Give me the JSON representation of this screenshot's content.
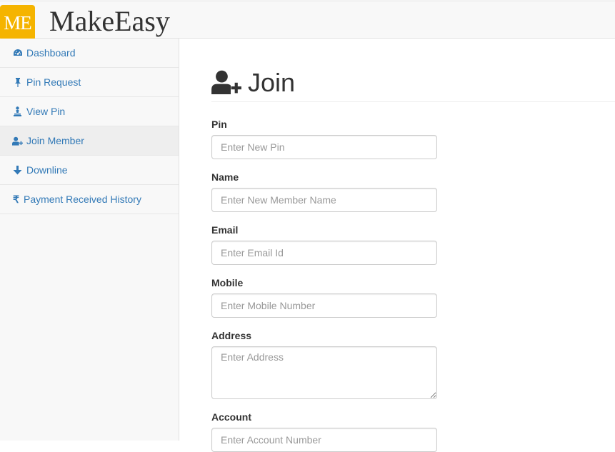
{
  "brand": {
    "logo_text": "ME",
    "name": "MakeEasy",
    "logo_color": "#f5b400"
  },
  "sidebar": {
    "items": [
      {
        "label": "Dashboard",
        "icon": "dashboard-icon",
        "active": false
      },
      {
        "label": "Pin Request",
        "icon": "pushpin-icon",
        "active": false
      },
      {
        "label": "View Pin",
        "icon": "pawn-icon",
        "active": false
      },
      {
        "label": "Join Member",
        "icon": "user-plus-icon",
        "active": true
      },
      {
        "label": "Downline",
        "icon": "arrow-down-icon",
        "active": false
      },
      {
        "label": "Payment Received History",
        "icon": "rupee-icon",
        "active": false
      }
    ],
    "link_color": "#337ab7"
  },
  "page": {
    "title": "Join",
    "title_icon": "user-plus-icon"
  },
  "form": {
    "pin": {
      "label": "Pin",
      "placeholder": "Enter New Pin",
      "value": ""
    },
    "name": {
      "label": "Name",
      "placeholder": "Enter New Member Name",
      "value": ""
    },
    "email": {
      "label": "Email",
      "placeholder": "Enter Email Id",
      "value": ""
    },
    "mobile": {
      "label": "Mobile",
      "placeholder": "Enter Mobile Number",
      "value": ""
    },
    "address": {
      "label": "Address",
      "placeholder": "Enter Address",
      "value": ""
    },
    "account": {
      "label": "Account",
      "placeholder": "Enter Account Number",
      "value": ""
    }
  }
}
